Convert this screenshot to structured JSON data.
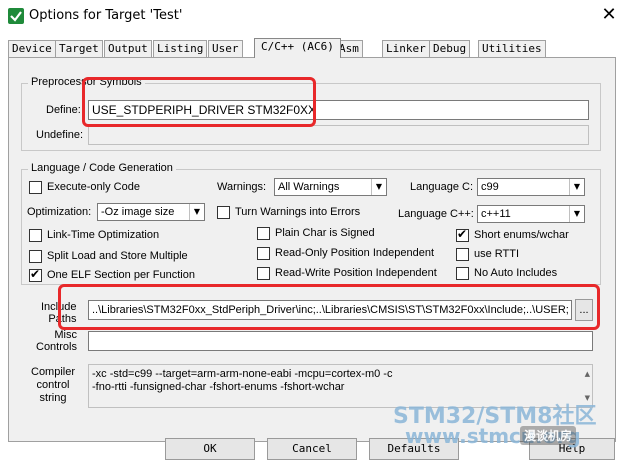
{
  "window": {
    "title": "Options for Target 'Test'",
    "close_glyph": "✕"
  },
  "tabs": [
    "Device",
    "Target",
    "Output",
    "Listing",
    "User",
    "C/C++ (AC6)",
    "Asm",
    "Linker",
    "Debug",
    "Utilities"
  ],
  "active_tab": "C/C++ (AC6)",
  "preprocessor": {
    "group_title": "Preprocessor Symbols",
    "define_label": "Define:",
    "define_value": "USE_STDPERIPH_DRIVER STM32F0XX",
    "undefine_label": "Undefine:",
    "undefine_value": ""
  },
  "language": {
    "group_title": "Language / Code Generation",
    "execute_only": "Execute-only Code",
    "warnings_label": "Warnings:",
    "warnings_value": "All Warnings",
    "language_c_label": "Language C:",
    "language_c_value": "c99",
    "optimization_label": "Optimization:",
    "optimization_value": "-Oz image size",
    "turn_warnings_errors": "Turn Warnings into Errors",
    "language_cpp_label": "Language C++:",
    "language_cpp_value": "c++11",
    "link_time": "Link-Time Optimization",
    "plain_char": "Plain Char is Signed",
    "short_enums": "Short enums/wchar",
    "split_load": "Split Load and Store Multiple",
    "read_only_pos": "Read-Only Position Independent",
    "use_rtti": "use RTTI",
    "one_elf": "One ELF Section per Function",
    "read_write_pos": "Read-Write Position Independent",
    "no_auto_includes": "No Auto Includes"
  },
  "include": {
    "label_line1": "Include",
    "label_line2": "Paths",
    "value": "..\\Libraries\\STM32F0xx_StdPeriph_Driver\\inc;..\\Libraries\\CMSIS\\ST\\STM32F0xx\\Include;..\\USER;",
    "browse_label": "..."
  },
  "misc": {
    "label_line1": "Misc",
    "label_line2": "Controls",
    "value": ""
  },
  "compiler": {
    "label_line1": "Compiler",
    "label_line2": "control",
    "label_line3": "string",
    "line1": "-xc -std=c99 --target=arm-arm-none-eabi -mcpu=cortex-m0 -c",
    "line2": "-fno-rtti -funsigned-char -fshort-enums -fshort-wchar"
  },
  "buttons": {
    "ok": "OK",
    "cancel": "Cancel",
    "defaults": "Defaults",
    "help": "Help"
  },
  "watermark": {
    "line1": "STM32/STM8社区",
    "line2": "www.stmcu.org",
    "badge": "漫谈机房"
  },
  "colors": {
    "highlight_box": "#e8282a",
    "watermark": "#8ab6d8"
  }
}
